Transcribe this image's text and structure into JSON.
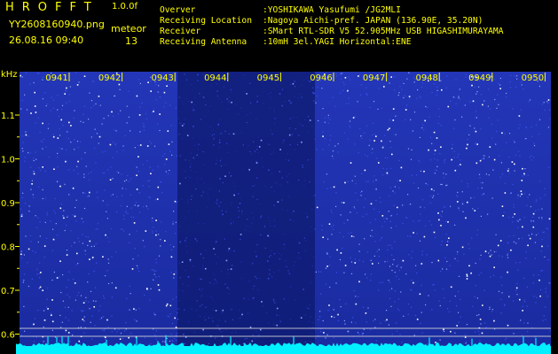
{
  "header": {
    "app_name": "HROFFT",
    "version": "1.0.0f",
    "filename": "YY2608160940.png",
    "datetime": "26.08.16 09:40",
    "mode_label": "meteor",
    "count": "13",
    "info": [
      {
        "label": "Overver",
        "value": ":YOSHIKAWA Yasufumi /JG2MLI"
      },
      {
        "label": "Receiving Location",
        "value": ":Nagoya Aichi-pref. JAPAN (136.90E, 35.20N)"
      },
      {
        "label": "Receiver",
        "value": ":SMart RTL-SDR V5 52.905MHz USB HIGASHIMURAYAMA"
      },
      {
        "label": "Receiving Antenna",
        "value": ":10mH 3el.YAGI Horizontal:ENE"
      }
    ]
  },
  "chart_data": {
    "type": "heatmap",
    "ylabel": "kHz",
    "y_ticks": [
      "1.1",
      "1.0",
      "0.9",
      "0.8",
      "0.7",
      "0.6"
    ],
    "time_labels": [
      "0941",
      "0942",
      "0943",
      "0944",
      "0945",
      "0946",
      "0947",
      "0948",
      "0949",
      "0950"
    ],
    "colors": {
      "background": "#000000",
      "noise_dark": "#00106e",
      "noise_bright": "#2a3cd0",
      "speck": "#ffffff",
      "baseline": "#00f0ff",
      "text": "#ffff00",
      "marker_line": "#d8d8d8"
    }
  }
}
